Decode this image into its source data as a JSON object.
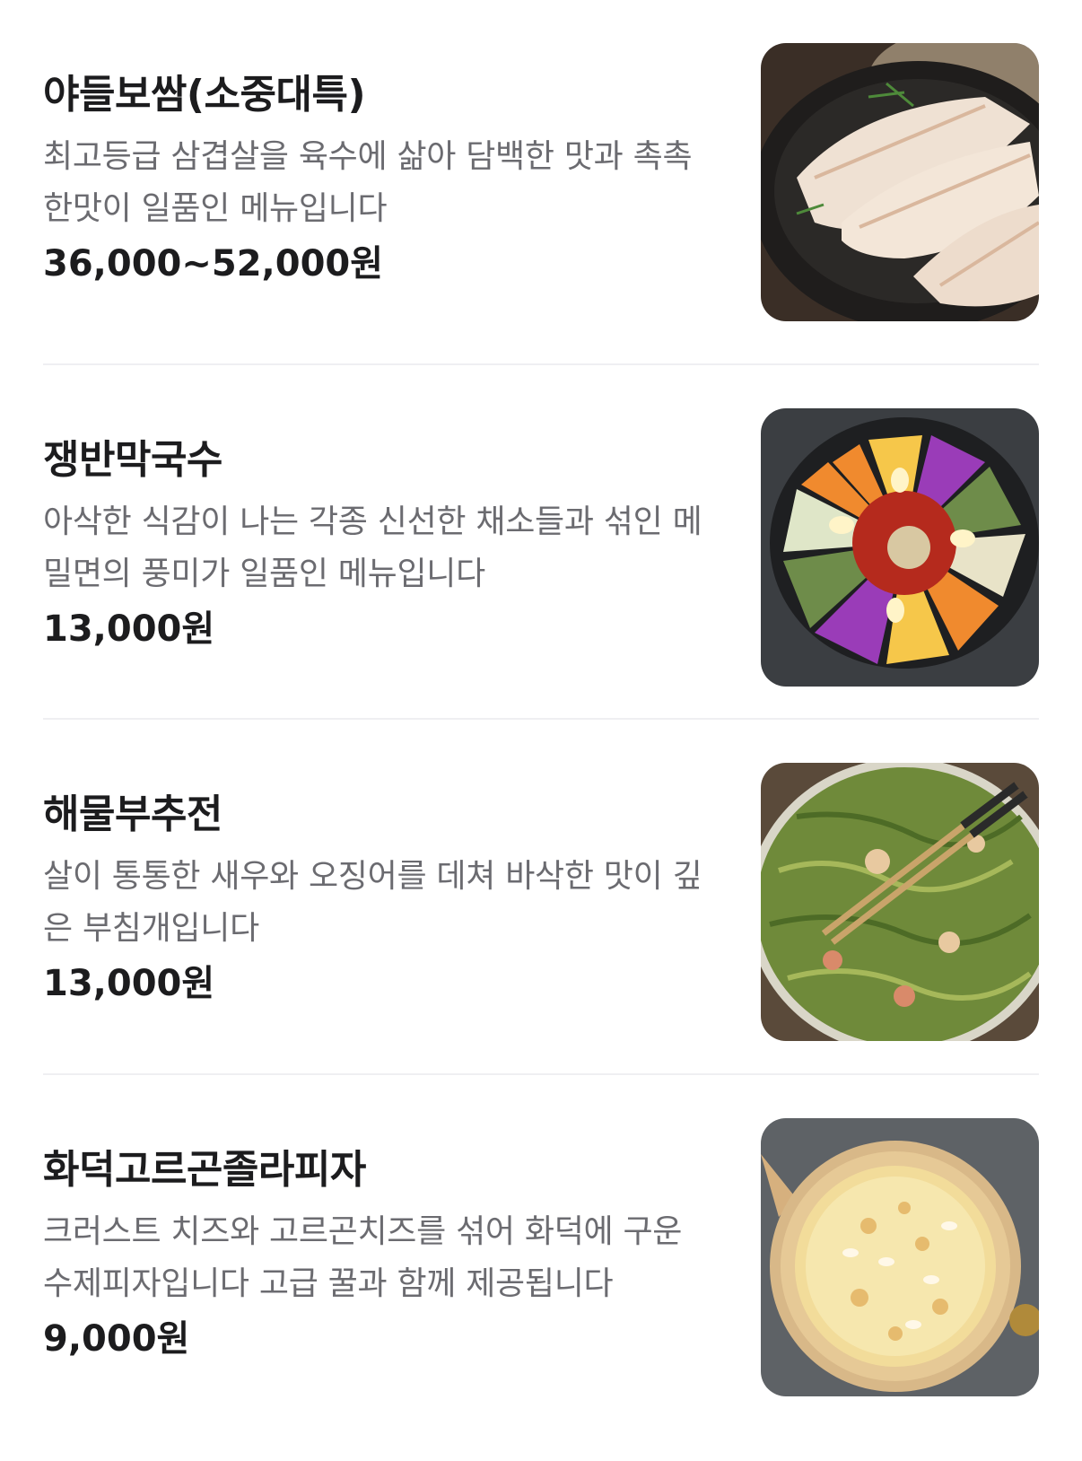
{
  "menu": {
    "items": [
      {
        "name": "야들보쌈(소중대특)",
        "description": "최고등급 삼겹살을 육수에 삶아 담백한 맛과 촉촉한맛이 일품인 메뉴입니다",
        "price": "36,000~52,000원",
        "photo_icon": "bossam-photo"
      },
      {
        "name": "쟁반막국수",
        "description": "아삭한 식감이 나는 각종 신선한 채소들과 섞인 메밀면의 풍미가 일품인 메뉴입니다",
        "price": "13,000원",
        "photo_icon": "makguksu-photo"
      },
      {
        "name": "해물부추전",
        "description": "살이 통통한 새우와 오징어를 데쳐 바삭한 맛이 깊은 부침개입니다",
        "price": "13,000원",
        "photo_icon": "buchujeon-photo"
      },
      {
        "name": "화덕고르곤졸라피자",
        "description": "크러스트 치즈와 고르곤치즈를 섞어 화덕에 구운 수제피자입니다 고급 꿀과 함께 제공됩니다",
        "price": "9,000원",
        "photo_icon": "pizza-photo"
      }
    ]
  },
  "colors": {
    "text_primary": "#1c1c1e",
    "text_secondary": "#6b6b70",
    "divider": "#efeff2",
    "background": "#ffffff"
  }
}
